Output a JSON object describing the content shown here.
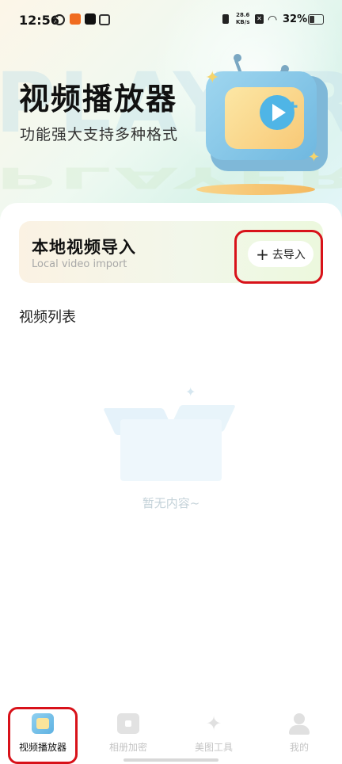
{
  "status_bar": {
    "time": "12:56",
    "net_speed_value": "28.6",
    "net_speed_unit": "KB/s",
    "battery": "32%"
  },
  "hero": {
    "title": "视频播放器",
    "subtitle": "功能强大支持多种格式",
    "watermark": "PLAYER"
  },
  "import_card": {
    "title": "本地视频导入",
    "subtitle": "Local video import",
    "button_label": "去导入",
    "button_icon": "plus-icon"
  },
  "video_list": {
    "heading": "视频列表",
    "empty_text": "暂无内容~"
  },
  "tab_bar": {
    "items": [
      {
        "label": "视频播放器",
        "icon": "video-player-icon",
        "active": true
      },
      {
        "label": "相册加密",
        "icon": "album-lock-icon",
        "active": false
      },
      {
        "label": "美图工具",
        "icon": "photo-wand-icon",
        "active": false
      },
      {
        "label": "我的",
        "icon": "profile-icon",
        "active": false
      }
    ]
  },
  "colors": {
    "highlight": "#d8121a",
    "accent_blue": "#4fb5e6",
    "accent_yellow": "#f8c977"
  }
}
